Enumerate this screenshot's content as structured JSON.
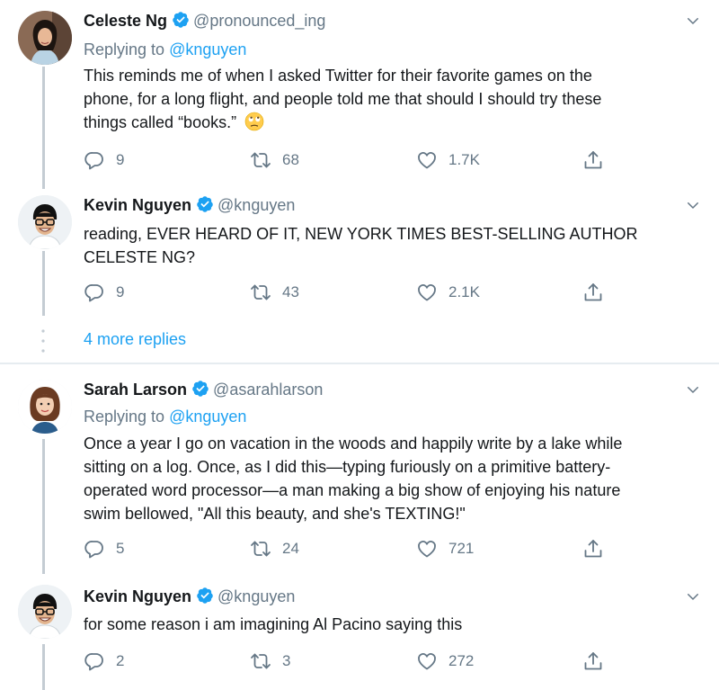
{
  "colors": {
    "accent": "#1da1f2",
    "text": "#14171a",
    "secondary": "#657786",
    "verified": "#1da1f2",
    "line": "#c4ccd3"
  },
  "tweets": [
    {
      "name": "Celeste Ng",
      "handle": "@pronounced_ing",
      "replying_prefix": "Replying to ",
      "replying_to": "@knguyen",
      "lines": [
        "This reminds me of when I asked Twitter for their favorite games on the",
        "phone, for a long flight, and people told me that should I should try these",
        "things called “books.”"
      ],
      "emoji": "face-with-rolling-eyes",
      "replies": "9",
      "retweets": "68",
      "likes": "1.7K"
    },
    {
      "name": "Kevin Nguyen",
      "handle": "@knguyen",
      "lines": [
        "reading, EVER HEARD OF IT, NEW YORK TIMES BEST-SELLING AUTHOR",
        "CELESTE NG?"
      ],
      "replies": "9",
      "retweets": "43",
      "likes": "2.1K"
    },
    {
      "name": "Sarah Larson",
      "handle": "@asarahlarson",
      "replying_prefix": "Replying to ",
      "replying_to": "@knguyen",
      "lines": [
        "Once a year I go on vacation in the woods and happily write by a lake while",
        "sitting on a log. Once, as I did this—typing furiously on a primitive battery-",
        "operated word processor—a man making a big show of enjoying his nature",
        "swim bellowed, \"All this beauty, and she's TEXTING!\""
      ],
      "replies": "5",
      "retweets": "24",
      "likes": "721"
    },
    {
      "name": "Kevin Nguyen",
      "handle": "@knguyen",
      "lines": [
        "for some reason i am imagining Al Pacino saying this"
      ],
      "replies": "2",
      "retweets": "3",
      "likes": "272"
    }
  ],
  "more_replies": "4 more replies",
  "icons": {
    "reply": "reply-icon",
    "retweet": "retweet-icon",
    "like": "heart-icon",
    "share": "share-icon",
    "verified": "verified-badge-icon",
    "caret": "chevron-down-icon"
  }
}
